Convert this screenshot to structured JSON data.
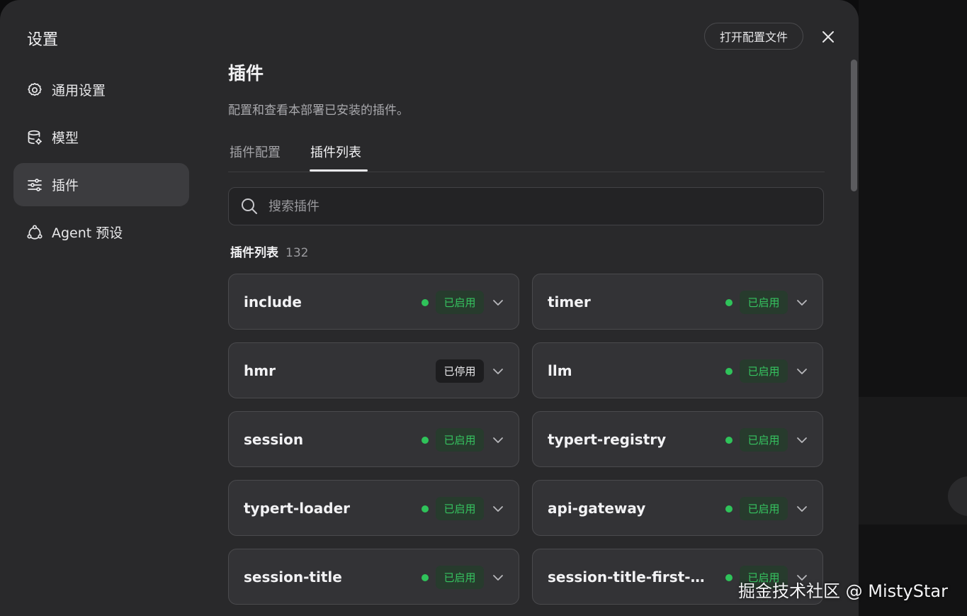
{
  "dialog": {
    "title": "设置",
    "open_config_label": "打开配置文件"
  },
  "nav": [
    {
      "label": "通用设置",
      "icon": "gear-icon"
    },
    {
      "label": "模型",
      "icon": "database-icon"
    },
    {
      "label": "插件",
      "icon": "sliders-icon",
      "active": true
    },
    {
      "label": "Agent 预设",
      "icon": "agent-network-icon"
    }
  ],
  "page": {
    "title": "插件",
    "description": "配置和查看本部署已安装的插件。",
    "tabs": [
      {
        "label": "插件配置"
      },
      {
        "label": "插件列表",
        "active": true
      }
    ],
    "search_placeholder": "搜索插件",
    "list_title": "插件列表",
    "list_count": "132"
  },
  "plugins": [
    {
      "name": "include",
      "status": "已启用",
      "enabled": true
    },
    {
      "name": "timer",
      "status": "已启用",
      "enabled": true
    },
    {
      "name": "hmr",
      "status": "已停用",
      "enabled": false
    },
    {
      "name": "llm",
      "status": "已启用",
      "enabled": true
    },
    {
      "name": "session",
      "status": "已启用",
      "enabled": true
    },
    {
      "name": "typert-registry",
      "status": "已启用",
      "enabled": true
    },
    {
      "name": "typert-loader",
      "status": "已启用",
      "enabled": true
    },
    {
      "name": "api-gateway",
      "status": "已启用",
      "enabled": true
    },
    {
      "name": "session-title",
      "status": "已启用",
      "enabled": true
    },
    {
      "name": "session-title-first-m...",
      "status": "已启用",
      "enabled": true
    }
  ],
  "colors": {
    "enabled_text": "#36c460",
    "enabled_dot": "#2fc35a",
    "panel_bg": "#29292b",
    "card_bg": "#333336"
  },
  "watermark": "掘金技术社区 @ MistyStar"
}
